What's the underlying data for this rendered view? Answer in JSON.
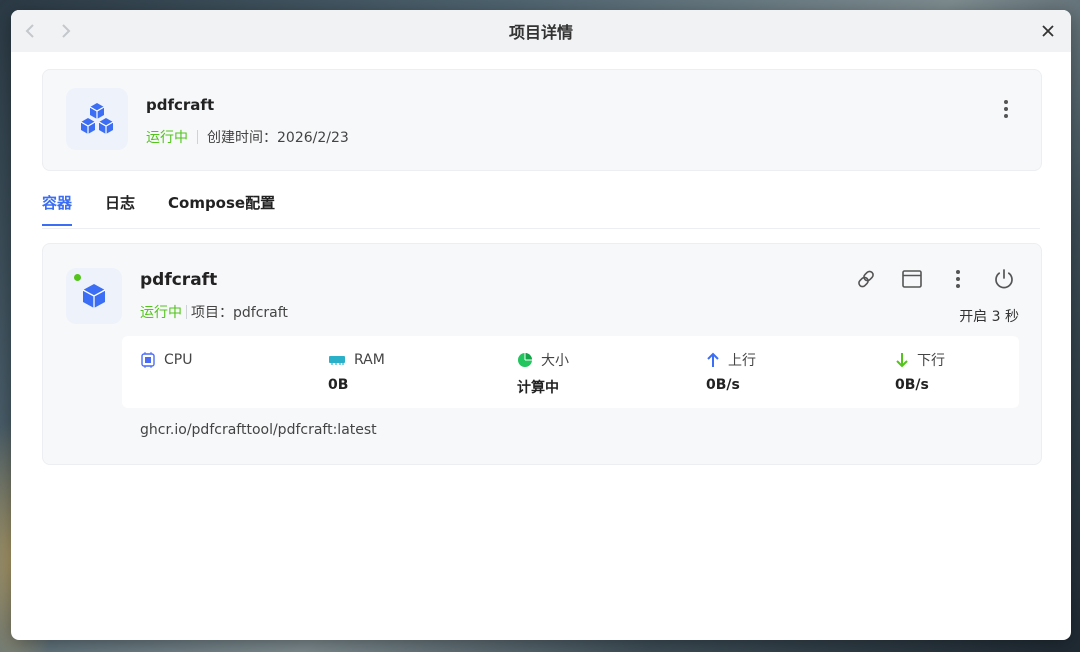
{
  "window": {
    "title": "项目详情",
    "back_icon": "chevron-left-icon",
    "forward_icon": "chevron-right-icon",
    "close_icon": "close-icon"
  },
  "project": {
    "name": "pdfcraft",
    "status": "运行中",
    "created_label": "创建时间：2026/2/23",
    "icon": "cubes-icon",
    "status_color": "#52c41a"
  },
  "tabs": [
    {
      "label": "容器",
      "active": true
    },
    {
      "label": "日志",
      "active": false
    },
    {
      "label": "Compose配置",
      "active": false
    }
  ],
  "container": {
    "name": "pdfcraft",
    "status": "运行中",
    "project_label": "项目：pdfcraft",
    "uptime": "开启 3 秒",
    "image": "ghcr.io/pdfcrafttool/pdfcraft:latest",
    "actions": [
      "link-icon",
      "terminal-window-icon",
      "more-icon",
      "power-icon"
    ]
  },
  "stats": [
    {
      "label": "CPU",
      "value": "",
      "icon": "cpu-icon"
    },
    {
      "label": "RAM",
      "value": "0B",
      "icon": "ram-icon"
    },
    {
      "label": "大小",
      "value": "计算中",
      "icon": "pie-icon"
    },
    {
      "label": "上行",
      "value": "0B/s",
      "icon": "arrow-up-icon"
    },
    {
      "label": "下行",
      "value": "0B/s",
      "icon": "arrow-down-icon"
    }
  ],
  "colors": {
    "accent": "#3b6ef5",
    "running": "#52c41a",
    "upload": "#3b6ef5",
    "download": "#52c41a"
  }
}
